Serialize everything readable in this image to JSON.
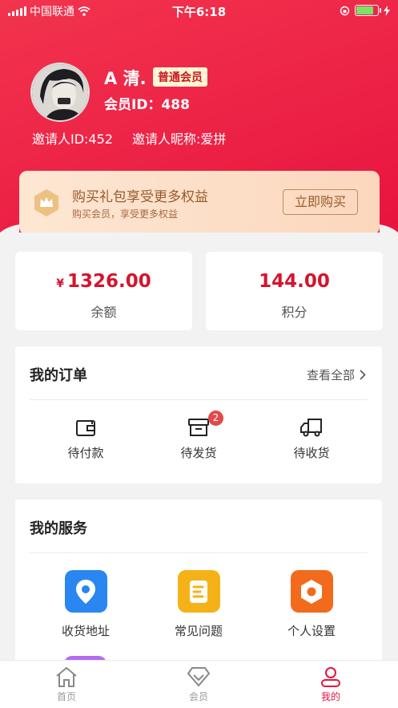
{
  "status_bar": {
    "carrier": "中国联通",
    "time": "下午6:18",
    "battery_level": 0.8
  },
  "profile": {
    "name": "A 清.",
    "member_level": "普通会员",
    "member_id": "会员ID：488",
    "inviter_id": "邀请人ID:452",
    "inviter_nickname": "邀请人昵称:爱拼"
  },
  "vip_banner": {
    "title": "购买礼包享受更多权益",
    "subtitle": "购买会员，享受更多权益",
    "button_label": "立即购买"
  },
  "wallet": {
    "balance_symbol": "¥",
    "balance_value": "1326.00",
    "balance_label": "余额",
    "points_value": "144.00",
    "points_label": "积分"
  },
  "orders": {
    "title": "我的订单",
    "view_all": "查看全部",
    "items": [
      {
        "label": "待付款",
        "icon": "wallet-icon"
      },
      {
        "label": "待发货",
        "icon": "box-icon",
        "badge": "2"
      },
      {
        "label": "待收货",
        "icon": "truck-icon"
      }
    ]
  },
  "services": {
    "title": "我的服务",
    "items": [
      {
        "label": "收货地址",
        "icon": "location-pin-icon",
        "color": "#2a86f0"
      },
      {
        "label": "常见问题",
        "icon": "faq-doc-icon",
        "color": "#f5b218"
      },
      {
        "label": "个人设置",
        "icon": "settings-hexagon-icon",
        "color": "#f26b1d"
      }
    ]
  },
  "tab_bar": {
    "items": [
      {
        "label": "首页",
        "icon": "home-icon",
        "active": false
      },
      {
        "label": "会员",
        "icon": "diamond-icon",
        "active": false
      },
      {
        "label": "我的",
        "icon": "user-icon",
        "active": true
      }
    ]
  },
  "colors": {
    "brand_red": "#e8133f",
    "price_red": "#d5142f",
    "vip_gold": "#9a5a2c",
    "badge_red": "#e24a4a"
  }
}
